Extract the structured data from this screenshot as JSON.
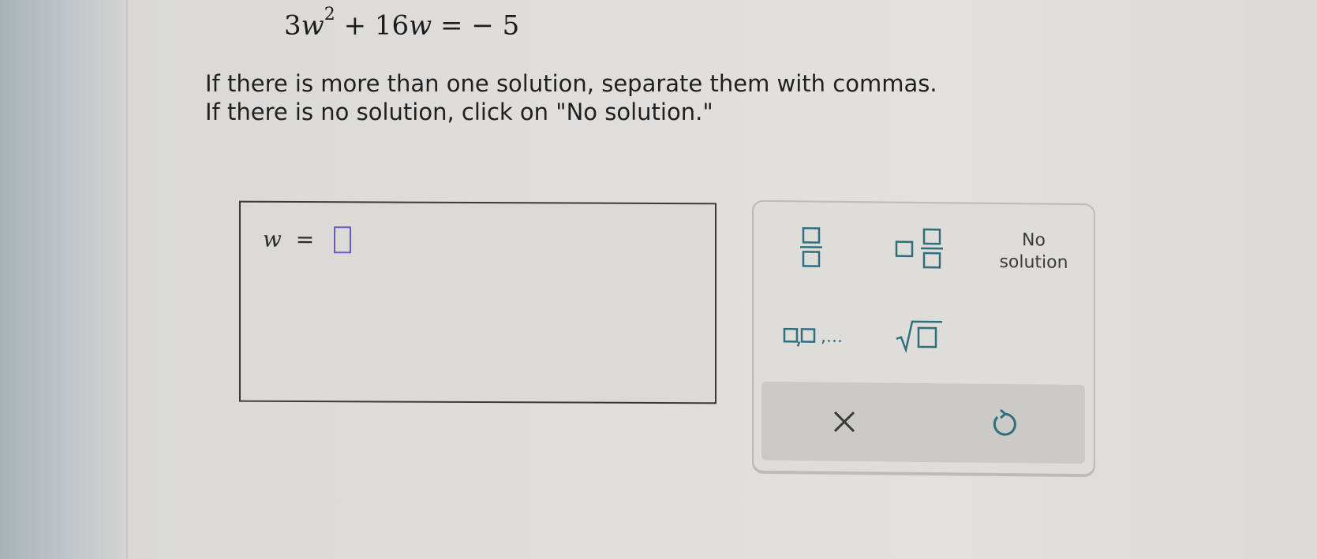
{
  "problem": {
    "equation_coef": "3",
    "equation_var": "w",
    "equation_exp": "2",
    "equation_rest_1": "+ 16",
    "equation_var_2": "w",
    "equation_rest_2": "= − 5",
    "instruction_line1": "If there is more than one solution, separate them with commas.",
    "instruction_line2": "If there is no solution, click on \"No solution.\""
  },
  "answer": {
    "variable": "w",
    "equals": "=",
    "value": ""
  },
  "keypad": {
    "keys": [
      {
        "name": "fraction",
        "icon": "fraction-icon"
      },
      {
        "name": "mixed-number",
        "icon": "mixed-number-icon"
      },
      {
        "name": "no-solution",
        "label_line1": "No",
        "label_line2": "solution"
      },
      {
        "name": "list",
        "icon": "list-icon",
        "suffix": ",..."
      },
      {
        "name": "square-root",
        "icon": "square-root-icon"
      }
    ],
    "actions": [
      {
        "name": "clear",
        "icon": "close-icon"
      },
      {
        "name": "undo",
        "icon": "undo-icon"
      }
    ]
  },
  "colors": {
    "key_teal": "#2f6e7c",
    "slot_purple": "#6a59c9",
    "screen_bg": "#dfddd9",
    "action_bar": "#cbcac7"
  }
}
